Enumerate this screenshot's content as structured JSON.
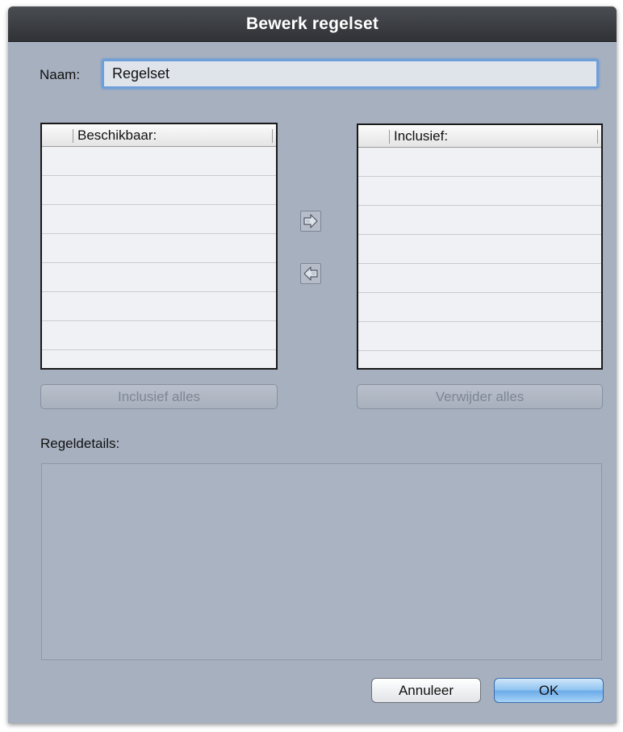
{
  "dialog": {
    "title": "Bewerk regelset"
  },
  "name_field": {
    "label": "Naam:",
    "value": "Regelset"
  },
  "available_list": {
    "header": "Beschikbaar:",
    "items": []
  },
  "included_list": {
    "header": "Inclusief:",
    "items": []
  },
  "transfer": {
    "add_icon": "arrow-right-icon",
    "remove_icon": "arrow-left-icon"
  },
  "buttons": {
    "include_all": "Inclusief alles",
    "remove_all": "Verwijder alles",
    "cancel": "Annuleer",
    "ok": "OK"
  },
  "details": {
    "label": "Regeldetails:",
    "content": ""
  },
  "colors": {
    "window_bg": "#a7b0bf",
    "titlebar_bg": "#303236",
    "focus_ring": "#6e9fd8",
    "default_button": "#8ec2f0"
  }
}
